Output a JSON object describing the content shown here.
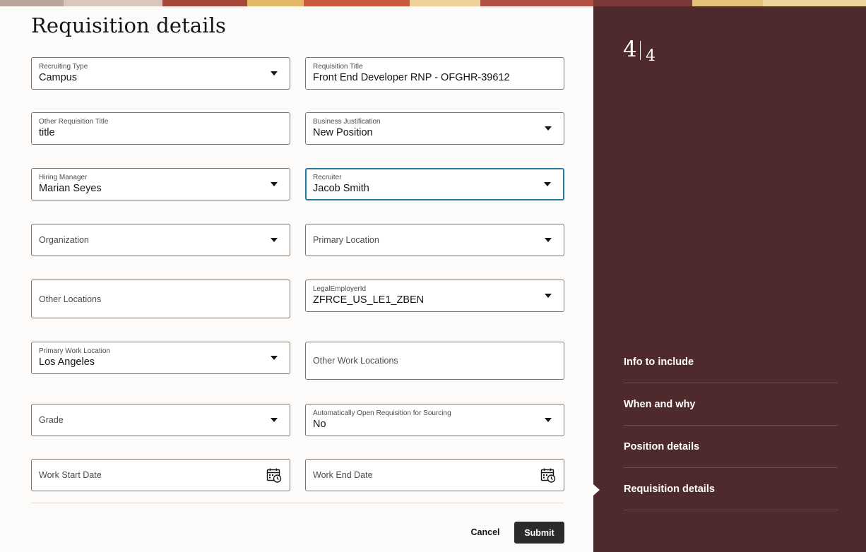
{
  "page": {
    "title": "Requisition details"
  },
  "colors": {
    "panel_bg": "#fcfbfa",
    "side_bg": "#4f2a2c",
    "focus_border": "#227e9e",
    "submit_bg": "#2b2b2b"
  },
  "fields": {
    "recruiting_type": {
      "label": "Recruiting Type",
      "value": "Campus"
    },
    "requisition_title": {
      "label": "Requisition Title",
      "value": "Front End Developer RNP - OFGHR-39612"
    },
    "other_requisition_title": {
      "label": "Other Requisition Title",
      "value": "title"
    },
    "business_justification": {
      "label": "Business Justification",
      "value": "New Position"
    },
    "hiring_manager": {
      "label": "Hiring Manager",
      "value": "Marian Seyes"
    },
    "recruiter": {
      "label": "Recruiter",
      "value": "Jacob Smith"
    },
    "organization": {
      "label": "Organization"
    },
    "primary_location": {
      "label": "Primary Location"
    },
    "other_locations": {
      "label": "Other Locations"
    },
    "legal_employer": {
      "label": "LegalEmployerId",
      "value": "ZFRCE_US_LE1_ZBEN"
    },
    "primary_work_location": {
      "label": "Primary Work Location",
      "value": "Los Angeles"
    },
    "other_work_locations": {
      "label": "Other Work Locations"
    },
    "grade": {
      "label": "Grade"
    },
    "auto_open": {
      "label": "Automatically Open Requisition for Sourcing",
      "value": "No"
    },
    "work_start_date": {
      "label": "Work Start Date"
    },
    "work_end_date": {
      "label": "Work End Date"
    }
  },
  "actions": {
    "cancel": "Cancel",
    "submit": "Submit"
  },
  "progress": {
    "current": "4",
    "total": "4"
  },
  "side_nav": [
    {
      "label": "Info to include"
    },
    {
      "label": "When and why"
    },
    {
      "label": "Position details"
    },
    {
      "label": "Requisition details",
      "active": true
    }
  ],
  "icons": {
    "dropdown": "caret-down-icon",
    "date": "calendar-icon"
  }
}
